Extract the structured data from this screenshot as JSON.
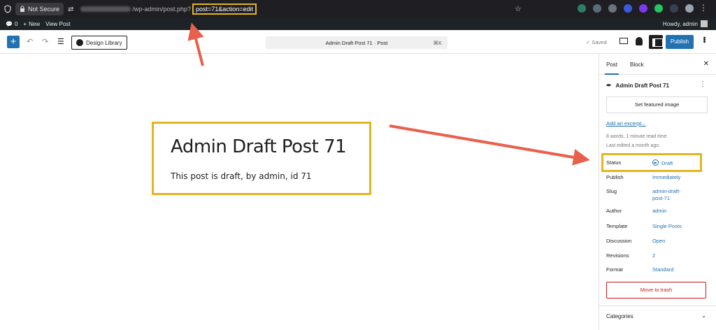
{
  "browser": {
    "security_label": "Not Secure",
    "url_path": "/wp-admin/post.php?",
    "url_query": "post=71&action=edit",
    "extension_colors": [
      "#2e7d6b",
      "#5b6b7a",
      "#6b7280",
      "#3b5bdb",
      "#7c3aed",
      "#22c55e",
      "#374151",
      "#9ca3af"
    ]
  },
  "admin_bar": {
    "comments_count": "0",
    "new_label": "New",
    "view_post_label": "View Post",
    "howdy": "Howdy, admin"
  },
  "toolbar": {
    "design_library_label": "Design Library",
    "document_title": "Admin Draft Post 71 · Post",
    "shortcut": "⌘K",
    "saved_label": "Saved",
    "publish_label": "Publish"
  },
  "post": {
    "title": "Admin Draft Post 71",
    "body": "This post is draft, by admin, id 71"
  },
  "sidebar": {
    "tabs": [
      "Post",
      "Block"
    ],
    "post_title": "Admin Draft Post 71",
    "featured_image_label": "Set featured image",
    "excerpt_link": "Add an excerpt...",
    "read_time": "8 words, 1 minute read time.",
    "last_edited": "Last edited a month ago.",
    "meta": [
      {
        "label": "Status",
        "value": "Draft"
      },
      {
        "label": "Publish",
        "value": "Immediately"
      },
      {
        "label": "Slug",
        "value": "admin-draft-post-71"
      },
      {
        "label": "Author",
        "value": "admin"
      },
      {
        "label": "Template",
        "value": "Single Posts"
      },
      {
        "label": "Discussion",
        "value": "Open"
      },
      {
        "label": "Revisions",
        "value": "2"
      },
      {
        "label": "Format",
        "value": "Standard"
      }
    ],
    "trash_label": "Move to trash",
    "categories_label": "Categories"
  },
  "colors": {
    "highlight": "#e6b422",
    "arrow": "#e8604c",
    "wp_blue": "#2271b1"
  }
}
